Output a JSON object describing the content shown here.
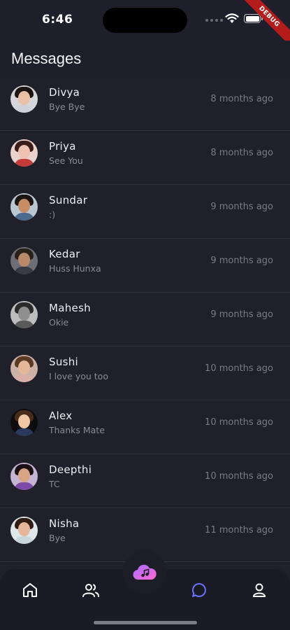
{
  "status": {
    "time": "6:46"
  },
  "debug_banner": "DEBUG",
  "header": {
    "title": "Messages"
  },
  "conversations": [
    {
      "name": "Divya",
      "preview": "Bye Bye",
      "time": "8 months ago",
      "skin": "#e9c1a6",
      "hair": "#1b1410",
      "shirt": "#cfd2da",
      "bg": "#d6d6da"
    },
    {
      "name": "Priya",
      "preview": "See You",
      "time": "8 months ago",
      "skin": "#f0c2b2",
      "hair": "#3b1d18",
      "shirt": "#c43a3a",
      "bg": "#e9d2cc"
    },
    {
      "name": "Sundar",
      "preview": ":)",
      "time": "9 months ago",
      "skin": "#c68d66",
      "hair": "#1c1410",
      "shirt": "#4c6a8c",
      "bg": "#b9c7d2"
    },
    {
      "name": "Kedar",
      "preview": "Huss Hunxa",
      "time": "9 months ago",
      "skin": "#b88a6a",
      "hair": "#2a201a",
      "shirt": "#3a3a44",
      "bg": "#6e6e76"
    },
    {
      "name": "Mahesh",
      "preview": "Okie",
      "time": "9 months ago",
      "skin": "#8f8f8f",
      "hair": "#2a2a2a",
      "shirt": "#5a5a5a",
      "bg": "#bdbdbd"
    },
    {
      "name": "Sushi",
      "preview": "I love you too",
      "time": "10 months ago",
      "skin": "#e3b799",
      "hair": "#5b3a26",
      "shirt": "#d9b0a8",
      "bg": "#cbb1a6"
    },
    {
      "name": "Alex",
      "preview": "Thanks Mate",
      "time": "10 months ago",
      "skin": "#f0c9a4",
      "hair": "#4a2c1a",
      "shirt": "#2b3a5c",
      "bg": "#0d0d0f"
    },
    {
      "name": "Deepthi",
      "preview": "TC",
      "time": "10 months ago",
      "skin": "#d9a483",
      "hair": "#1a1014",
      "shirt": "#7e4aa8",
      "bg": "#c6b4d4"
    },
    {
      "name": "Nisha",
      "preview": "Bye",
      "time": "11 months ago",
      "skin": "#e6b69a",
      "hair": "#2f1c14",
      "shirt": "#c9d6dc",
      "bg": "#dfe6e9"
    }
  ],
  "nav": {
    "items": [
      {
        "icon": "home-icon",
        "active": false
      },
      {
        "icon": "people-icon",
        "active": false
      },
      {
        "icon": "chat-bubble-icon",
        "active": true
      },
      {
        "icon": "profile-icon",
        "active": false
      }
    ],
    "center_icon": "music-cloud-icon"
  },
  "colors": {
    "background": "#20202b",
    "nav_background": "#1b1b26",
    "active_icon": "#6c74ff",
    "accent_gradient_start": "#a86bff",
    "accent_gradient_end": "#ff6ad5"
  }
}
